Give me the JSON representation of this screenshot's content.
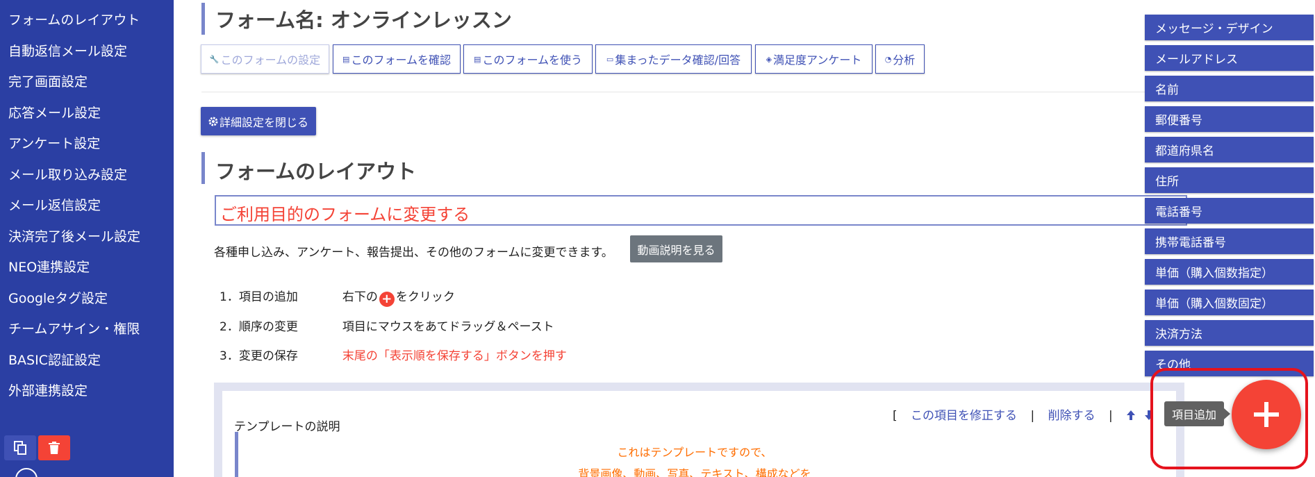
{
  "sidebar": {
    "items": [
      "フォームのレイアウト",
      "自動返信メール設定",
      "完了画面設定",
      "応答メール設定",
      "アンケート設定",
      "メール取り込み設定",
      "メール返信設定",
      "決済完了後メール設定",
      "NEO連携設定",
      "Googleタグ設定",
      "チームアサイン・権限",
      "BASIC認証設定",
      "外部連携設定"
    ],
    "copy_icon": "copy-icon",
    "delete_icon": "trash-icon"
  },
  "header": {
    "form_title": "フォーム名: オンラインレッスン"
  },
  "tabs": [
    {
      "label": "このフォームの設定",
      "icon": "wrench-icon",
      "disabled": true
    },
    {
      "label": "このフォームを確認",
      "icon": "document-icon",
      "disabled": false
    },
    {
      "label": "このフォームを使う",
      "icon": "document-icon",
      "disabled": false
    },
    {
      "label": "集まったデータ確認/回答",
      "icon": "message-icon",
      "disabled": false
    },
    {
      "label": "満足度アンケート",
      "icon": "layers-icon",
      "disabled": false
    },
    {
      "label": "分析",
      "icon": "chart-icon",
      "disabled": false
    }
  ],
  "close_detail_label": "詳細設定を閉じる",
  "layout": {
    "title": "フォームのレイアウト",
    "change_form": "ご利用目的のフォームに変更する",
    "description": "各種申し込み、アンケート、報告提出、その他のフォームに変更できます。",
    "video_button": "動画説明を見る",
    "steps": [
      {
        "num": "1．",
        "label": "項目の追加",
        "pre": "右下の",
        "post": "をクリック"
      },
      {
        "num": "2．",
        "label": "順序の変更",
        "text": "項目にマウスをあてドラッグ＆ペースト"
      },
      {
        "num": "3．",
        "label": "変更の保存",
        "text": "末尾の「表示順を保存する」ボタンを押す"
      }
    ]
  },
  "template": {
    "bracket_open": "[",
    "edit_link": "この項目を修正する",
    "separator": "|",
    "delete_link": "削除する",
    "label": "テンプレートの説明",
    "lines": [
      "これはテンプレートですので、",
      "背景画像、動画、写真、テキスト、構成などを"
    ]
  },
  "fab_menu": {
    "items": [
      "メッセージ・デザイン",
      "メールアドレス",
      "名前",
      "郵便番号",
      "都道府県名",
      "住所",
      "電話番号",
      "携帯電話番号",
      "単価（購入個数指定）",
      "単価（購入個数固定）",
      "決済方法",
      "その他"
    ],
    "tooltip": "項目追加"
  }
}
